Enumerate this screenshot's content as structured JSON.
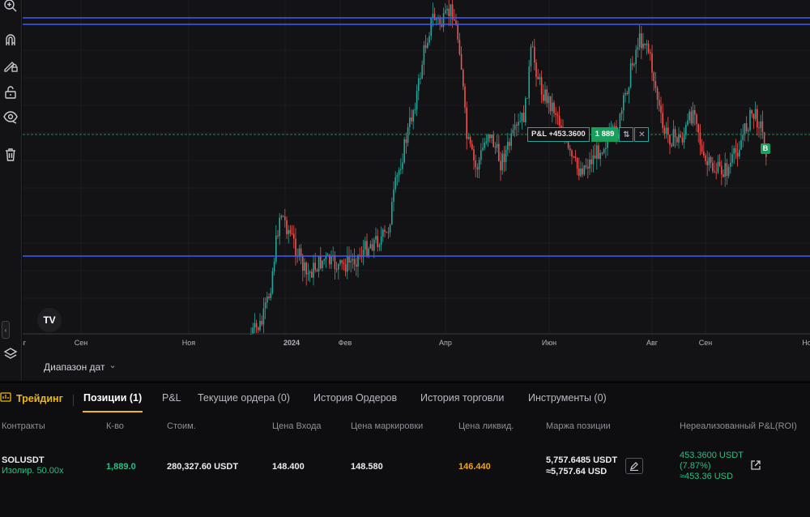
{
  "toolbar": {
    "icons": [
      "zoom-in-icon",
      "magnet-icon",
      "lock-drawing-icon",
      "unlock-icon",
      "eye-icon",
      "trash-icon",
      "layers-icon"
    ]
  },
  "chart": {
    "x_axis_labels": [
      "вг",
      "Сен",
      "Ноя",
      "2024",
      "Фев",
      "Апр",
      "Июн",
      "Авг",
      "Сен",
      "Но"
    ],
    "position_line": {
      "pnl_text": "P&L +453.3600",
      "qty": "1 889",
      "reverse_glyph": "⇅",
      "close_glyph": "✕"
    },
    "buy_marker": "B",
    "logo_text": "TV",
    "colors": {
      "up": "#26a69a",
      "down": "#ef5350",
      "level_line": "#3d5afe",
      "position_line": "#1f8a4c"
    }
  },
  "date_range": {
    "label": "Диапазон дат",
    "chevron": "⌄"
  },
  "tabs": {
    "trading": "Трейдинг",
    "items": [
      {
        "label": "Позиции (1)",
        "active": true
      },
      {
        "label": "P&L",
        "active": false
      },
      {
        "label": "Текущие ордера (0)",
        "active": false
      },
      {
        "label": "История Ордеров",
        "active": false
      },
      {
        "label": "История торговли",
        "active": false
      },
      {
        "label": "Инструменты (0)",
        "active": false
      }
    ]
  },
  "positions": {
    "headers": [
      "Контракты",
      "К-во",
      "Стоим.",
      "Цена Входа",
      "Цена маркировки",
      "Цена ликвид.",
      "Маржа позиции",
      "Нереализованный P&L(ROI)"
    ],
    "row": {
      "symbol": "SOLUSDT",
      "margin_mode": "Изолир. 50.00x",
      "qty": "1,889.0",
      "value": "280,327.60 USDT",
      "entry_price": "148.400",
      "mark_price": "148.580",
      "liq_price": "146.440",
      "margin_usdt": "5,757.6485 USDT",
      "margin_usd": "≈5,757.64 USD",
      "pnl_usdt": "453.3600 USDT",
      "pnl_roi": "(7.87%)",
      "pnl_usd": "≈453.36 USD"
    }
  }
}
